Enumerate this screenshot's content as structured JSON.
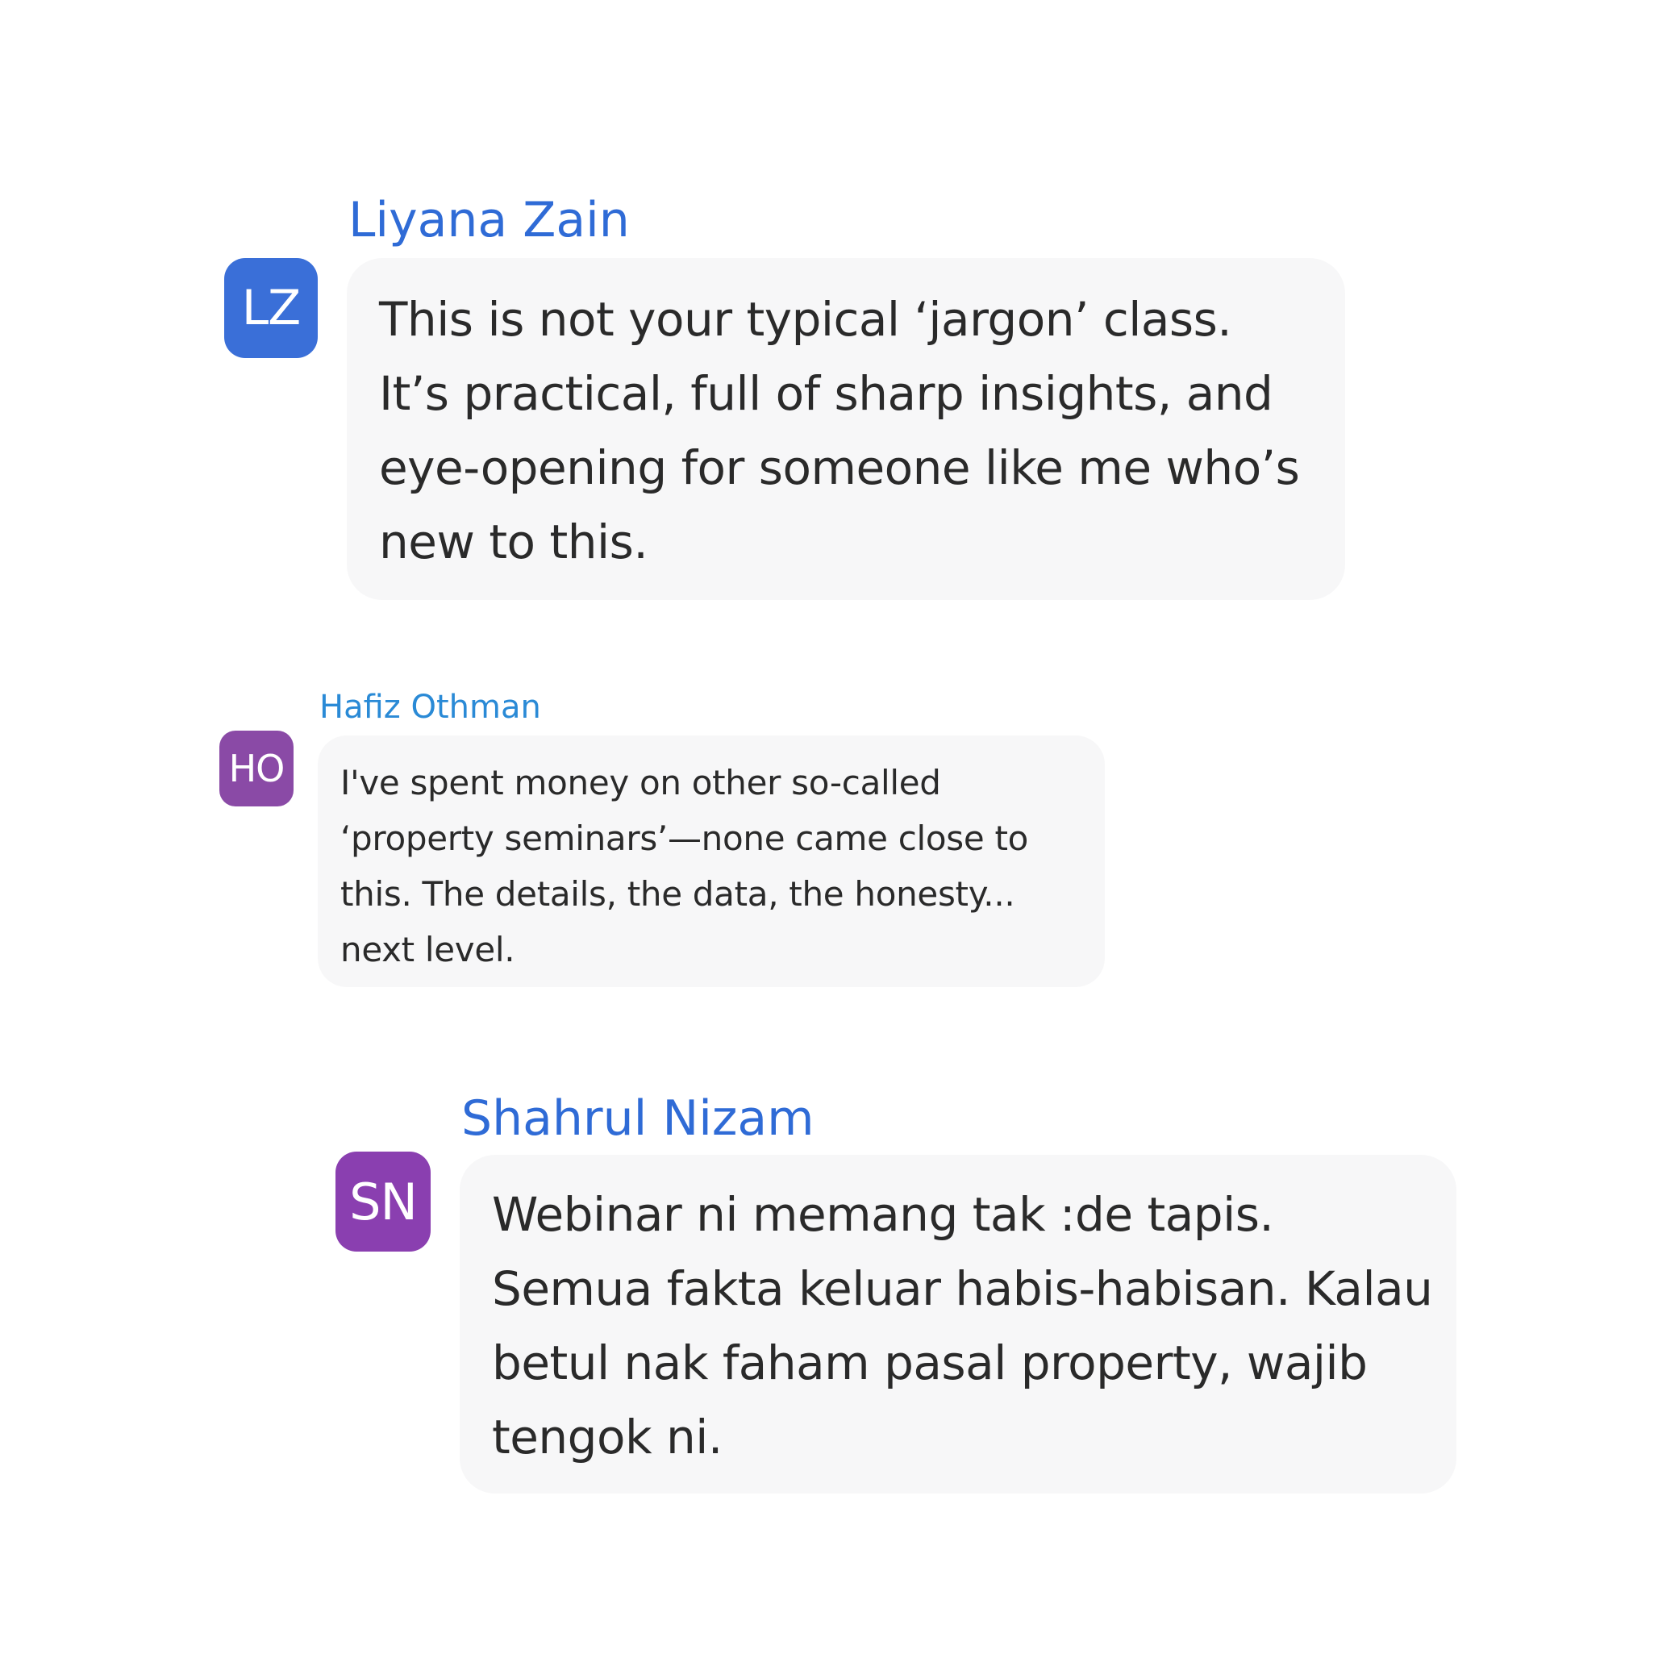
{
  "messages": [
    {
      "author": "Liyana Zain",
      "initials": "LZ",
      "avatar_color": "#3a6fd8",
      "name_color": "#2f6bd6",
      "lines": [
        "This is not your typical ‘jargon’ class.",
        "It’s practical, full of sharp insights,  and",
        "eye-opening for someone like me who’s",
        "new to this."
      ]
    },
    {
      "author": "Hafiz Othman",
      "initials": "HO",
      "avatar_color": "#8a4aa6",
      "name_color": "#2a8ad6",
      "lines": [
        "I've spent money on other so-called",
        "‘property seminars’—none came close to",
        "this. The details, the data, the honesty...",
        "next level."
      ]
    },
    {
      "author": "Shahrul Nizam",
      "initials": "SN",
      "avatar_color": "#8a3fb0",
      "name_color": "#2f6bd6",
      "lines": [
        "Webinar ni memang tak :de tapis.",
        "Semua fakta keluar habis-habisan. Kalau",
        "betul nak faham pasal property,  wajib",
        "tengok ni."
      ]
    }
  ]
}
